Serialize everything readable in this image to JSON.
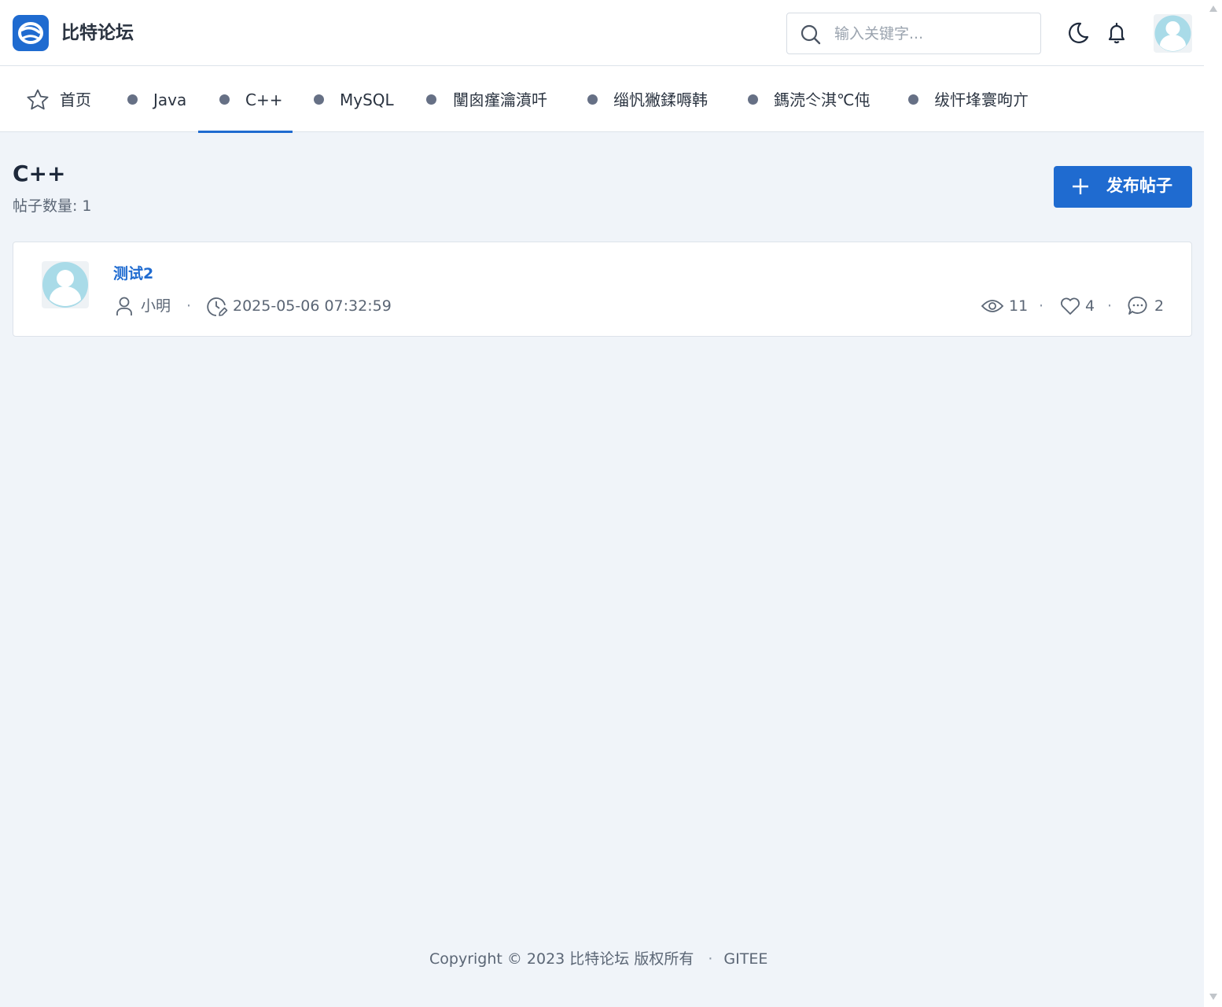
{
  "header": {
    "brand": "比特论坛",
    "search_placeholder": "输入关键字..."
  },
  "nav": {
    "items": [
      {
        "label": "首页",
        "icon": "star-icon"
      },
      {
        "label": "Java"
      },
      {
        "label": "C++",
        "active": true
      },
      {
        "label": "MySQL"
      },
      {
        "label": "闉囪瘽瀹濆吀"
      },
      {
        "label": "缁忛獙鍒嗕韩"
      },
      {
        "label": "鎷涜仒淇℃伅"
      },
      {
        "label": "绂忓埄寰呴亣"
      }
    ]
  },
  "section": {
    "title": "C++",
    "count_label": "帖子数量:",
    "count_value": "1",
    "new_post_label": "发布帖子"
  },
  "posts": [
    {
      "title": "测试2",
      "author": "小明",
      "time": "2025-05-06 07:32:59",
      "views": "11",
      "likes": "4",
      "comments": "2"
    }
  ],
  "footer": {
    "copyright": "Copyright © 2023 比特论坛 版权所有",
    "separator": "·",
    "link": "GITEE"
  },
  "colors": {
    "accent": "#1f6bd0",
    "background": "#f0f4f9",
    "avatar_tint": "#a9dbe8"
  }
}
